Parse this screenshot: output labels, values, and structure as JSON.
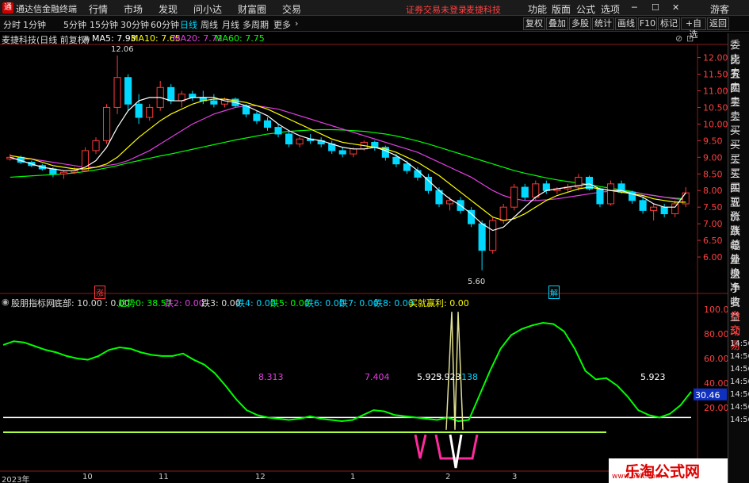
{
  "app": {
    "title": "通达信金融终端",
    "menus": [
      "行情",
      "市场",
      "发现",
      "问小达",
      "财富圈",
      "交易"
    ],
    "rmenus": [
      "功能",
      "版面",
      "公式",
      "选项"
    ],
    "alert": "证券交易未登录",
    "stock_name": "麦捷科技",
    "guest": "游客"
  },
  "periods": [
    "分时",
    "1分钟",
    "5分钟",
    "15分钟",
    "30分钟",
    "60分钟",
    "日线",
    "周线",
    "月线",
    "多周期",
    "更多"
  ],
  "right_buttons": [
    "复权",
    "叠加",
    "多股",
    "统计",
    "画线",
    "F10",
    "标记",
    "+自选",
    "返回"
  ],
  "info": {
    "name": "麦捷科技(日线 前复权)",
    "ma5": "MA5: 7.93",
    "ma10": "MA10: 7.65",
    "ma20": "MA20: 7.72",
    "ma60": "MA60: 7.75"
  },
  "price_axis": {
    "ticks": [
      "12.00",
      "11.50",
      "11.00",
      "10.50",
      "10.00",
      "9.50",
      "9.00",
      "8.50",
      "8.00",
      "7.50",
      "7.00",
      "6.50",
      "6.00"
    ]
  },
  "annotations": {
    "high": "12.06",
    "low": "5.60",
    "zhang": "涨",
    "jie": "解"
  },
  "side_labels": [
    "委比",
    "卖五",
    "卖四",
    "卖三",
    "卖二",
    "卖一",
    "买一",
    "买二",
    "买三",
    "买四",
    "买五",
    "现价",
    "涨跌",
    "涨幅",
    "总量",
    "外盘",
    "换手",
    "净资",
    "收益",
    "自动",
    "交易"
  ],
  "side_times": [
    "14:56",
    "14:56",
    "14:56",
    "14:56",
    "14:56",
    "14:56",
    "14:56"
  ],
  "indicator": {
    "name": "股朋指标网",
    "p1": "底部: 10.00 : 0.00",
    "p2": "趋势0: 38.57",
    "p3": "跌2: 0.00",
    "p4": "跌3: 0.00",
    "p5": "跌4: 0.00",
    "p6": "跌5: 0.00",
    "p7": "跌6: 0.00",
    "p8": "跌7: 0.00",
    "p9": "跌8: 0.00",
    "p10": "买就赢利: 0.00",
    "axis": [
      "100.0",
      "80.00",
      "60.00",
      "40.00",
      "20.00"
    ],
    "current": "30.46",
    "labels": [
      "8.313",
      "7.404",
      "5.923",
      "5.923",
      "138",
      "5.923"
    ]
  },
  "timeline": [
    "2023年",
    "10",
    "11",
    "12",
    "1",
    "2",
    "3"
  ],
  "watermark": {
    "text": "乐淘公式网",
    "url": "www.60lt.com"
  },
  "colors": {
    "up": "#ff3a3a",
    "down": "#00d8ff",
    "ma5": "#ffffff",
    "ma10": "#ffff00",
    "ma20": "#e23fe2",
    "ma60": "#00ff00",
    "indicator": "#00ff00"
  },
  "chart_data": {
    "type": "candlestick",
    "title": "麦捷科技(日线 前复权)",
    "ylim": [
      5.5,
      12.3
    ],
    "ohlc": [
      [
        8.95,
        9.1,
        8.9,
        9.0
      ],
      [
        9.0,
        9.05,
        8.8,
        8.85
      ],
      [
        8.85,
        8.9,
        8.7,
        8.75
      ],
      [
        8.75,
        8.8,
        8.6,
        8.65
      ],
      [
        8.65,
        8.7,
        8.4,
        8.5
      ],
      [
        8.5,
        8.6,
        8.35,
        8.55
      ],
      [
        8.55,
        8.7,
        8.5,
        8.6
      ],
      [
        8.6,
        9.3,
        8.55,
        9.2
      ],
      [
        9.2,
        9.6,
        9.1,
        9.5
      ],
      [
        9.5,
        10.6,
        9.4,
        10.5
      ],
      [
        10.5,
        12.06,
        10.3,
        11.4
      ],
      [
        11.4,
        11.5,
        10.4,
        10.6
      ],
      [
        10.6,
        10.9,
        10.0,
        10.2
      ],
      [
        10.2,
        10.6,
        10.1,
        10.5
      ],
      [
        10.5,
        11.3,
        10.4,
        11.1
      ],
      [
        11.1,
        11.2,
        10.6,
        10.7
      ],
      [
        10.7,
        11.0,
        10.5,
        10.9
      ],
      [
        10.9,
        11.0,
        10.7,
        10.8
      ],
      [
        10.8,
        11.0,
        10.6,
        10.7
      ],
      [
        10.7,
        10.9,
        10.5,
        10.6
      ],
      [
        10.6,
        10.8,
        10.5,
        10.75
      ],
      [
        10.75,
        10.8,
        10.5,
        10.55
      ],
      [
        10.55,
        10.6,
        10.2,
        10.3
      ],
      [
        10.3,
        10.4,
        10.0,
        10.1
      ],
      [
        10.1,
        10.2,
        9.8,
        9.9
      ],
      [
        9.9,
        10.0,
        9.6,
        9.7
      ],
      [
        9.7,
        9.8,
        9.3,
        9.4
      ],
      [
        9.4,
        9.6,
        9.3,
        9.55
      ],
      [
        9.55,
        9.7,
        9.4,
        9.5
      ],
      [
        9.5,
        9.6,
        9.3,
        9.4
      ],
      [
        9.4,
        9.5,
        9.1,
        9.2
      ],
      [
        9.2,
        9.3,
        9.0,
        9.1
      ],
      [
        9.1,
        9.3,
        9.0,
        9.25
      ],
      [
        9.25,
        9.5,
        9.2,
        9.45
      ],
      [
        9.45,
        9.5,
        9.2,
        9.3
      ],
      [
        9.3,
        9.35,
        8.9,
        9.0
      ],
      [
        9.0,
        9.1,
        8.7,
        8.8
      ],
      [
        8.8,
        8.9,
        8.5,
        8.6
      ],
      [
        8.6,
        8.7,
        8.3,
        8.4
      ],
      [
        8.4,
        8.5,
        7.9,
        8.0
      ],
      [
        8.0,
        8.1,
        7.5,
        7.6
      ],
      [
        7.6,
        7.8,
        7.4,
        7.7
      ],
      [
        7.7,
        7.8,
        7.3,
        7.4
      ],
      [
        7.4,
        7.5,
        6.9,
        7.0
      ],
      [
        7.0,
        7.1,
        5.6,
        6.2
      ],
      [
        6.2,
        7.2,
        6.1,
        7.1
      ],
      [
        7.1,
        7.6,
        7.0,
        7.5
      ],
      [
        7.5,
        8.2,
        7.4,
        8.1
      ],
      [
        8.1,
        8.2,
        7.7,
        7.8
      ],
      [
        7.8,
        8.3,
        7.7,
        8.2
      ],
      [
        8.2,
        8.3,
        7.9,
        8.0
      ],
      [
        8.0,
        8.1,
        7.9,
        8.05
      ],
      [
        8.05,
        8.2,
        7.95,
        8.1
      ],
      [
        8.1,
        8.5,
        8.0,
        8.4
      ],
      [
        8.4,
        8.45,
        8.0,
        8.05
      ],
      [
        8.05,
        8.1,
        7.5,
        7.6
      ],
      [
        7.6,
        8.3,
        7.55,
        8.2
      ],
      [
        8.2,
        8.3,
        7.9,
        7.95
      ],
      [
        7.95,
        8.0,
        7.6,
        7.7
      ],
      [
        7.7,
        7.8,
        7.3,
        7.4
      ],
      [
        7.4,
        7.6,
        7.1,
        7.5
      ],
      [
        7.5,
        7.6,
        7.2,
        7.3
      ],
      [
        7.3,
        7.7,
        7.2,
        7.6
      ],
      [
        7.6,
        8.1,
        7.5,
        7.93
      ]
    ],
    "ma5": [
      9.0,
      8.9,
      8.8,
      8.7,
      8.65,
      8.6,
      8.6,
      8.7,
      8.9,
      9.3,
      9.9,
      10.4,
      10.7,
      10.8,
      10.8,
      10.7,
      10.7,
      10.8,
      10.8,
      10.8,
      10.7,
      10.65,
      10.55,
      10.4,
      10.25,
      10.0,
      9.8,
      9.65,
      9.55,
      9.5,
      9.4,
      9.3,
      9.25,
      9.25,
      9.3,
      9.2,
      9.05,
      8.85,
      8.6,
      8.3,
      8.0,
      7.75,
      7.55,
      7.3,
      7.0,
      6.8,
      6.9,
      7.2,
      7.5,
      7.8,
      8.0,
      8.05,
      8.1,
      8.15,
      8.2,
      8.05,
      8.0,
      8.0,
      7.9,
      7.8,
      7.6,
      7.5,
      7.5,
      7.93
    ],
    "ma10": [
      9.05,
      9.0,
      8.95,
      8.85,
      8.75,
      8.7,
      8.65,
      8.65,
      8.7,
      8.8,
      9.0,
      9.3,
      9.6,
      9.85,
      10.1,
      10.3,
      10.45,
      10.6,
      10.7,
      10.75,
      10.75,
      10.7,
      10.65,
      10.55,
      10.45,
      10.3,
      10.15,
      10.0,
      9.85,
      9.7,
      9.55,
      9.45,
      9.4,
      9.35,
      9.3,
      9.25,
      9.15,
      9.0,
      8.85,
      8.65,
      8.45,
      8.2,
      7.95,
      7.7,
      7.45,
      7.2,
      7.1,
      7.15,
      7.3,
      7.5,
      7.7,
      7.85,
      7.95,
      8.05,
      8.1,
      8.05,
      8.0,
      7.95,
      7.9,
      7.85,
      7.75,
      7.7,
      7.65,
      7.65
    ],
    "ma20": [
      8.95,
      8.95,
      8.95,
      8.9,
      8.85,
      8.8,
      8.75,
      8.7,
      8.7,
      8.75,
      8.8,
      8.9,
      9.05,
      9.2,
      9.4,
      9.6,
      9.8,
      10.0,
      10.15,
      10.3,
      10.4,
      10.5,
      10.55,
      10.55,
      10.5,
      10.45,
      10.35,
      10.25,
      10.15,
      10.05,
      9.95,
      9.85,
      9.75,
      9.65,
      9.55,
      9.45,
      9.35,
      9.25,
      9.15,
      9.0,
      8.85,
      8.7,
      8.55,
      8.4,
      8.2,
      8.0,
      7.85,
      7.75,
      7.7,
      7.7,
      7.72,
      7.75,
      7.8,
      7.85,
      7.9,
      7.95,
      7.98,
      7.98,
      7.96,
      7.9,
      7.85,
      7.8,
      7.75,
      7.72
    ],
    "ma60": [
      8.4,
      8.42,
      8.44,
      8.46,
      8.48,
      8.5,
      8.53,
      8.57,
      8.62,
      8.68,
      8.75,
      8.83,
      8.9,
      8.97,
      9.04,
      9.1,
      9.17,
      9.24,
      9.31,
      9.38,
      9.45,
      9.52,
      9.58,
      9.64,
      9.7,
      9.74,
      9.78,
      9.8,
      9.82,
      9.83,
      9.83,
      9.82,
      9.8,
      9.78,
      9.74,
      9.7,
      9.64,
      9.57,
      9.49,
      9.4,
      9.3,
      9.2,
      9.1,
      9.0,
      8.9,
      8.8,
      8.7,
      8.6,
      8.52,
      8.45,
      8.38,
      8.32,
      8.27,
      8.22,
      8.18,
      8.12,
      8.07,
      8.02,
      7.97,
      7.9,
      7.85,
      7.8,
      7.77,
      7.75
    ],
    "trend": [
      71,
      74,
      73,
      70,
      67,
      65,
      62,
      60,
      59,
      62,
      67,
      69,
      68,
      65,
      63,
      62,
      62,
      64,
      59,
      55,
      48,
      38,
      27,
      18,
      14,
      12,
      11,
      10,
      11,
      13,
      11,
      10,
      9,
      10,
      14,
      18,
      17,
      14,
      13,
      12,
      11,
      10,
      12,
      9,
      10,
      30,
      50,
      68,
      79,
      84,
      87,
      89,
      88,
      82,
      68,
      50,
      43,
      44,
      38,
      29,
      18,
      14,
      12,
      15,
      22,
      33
    ]
  }
}
